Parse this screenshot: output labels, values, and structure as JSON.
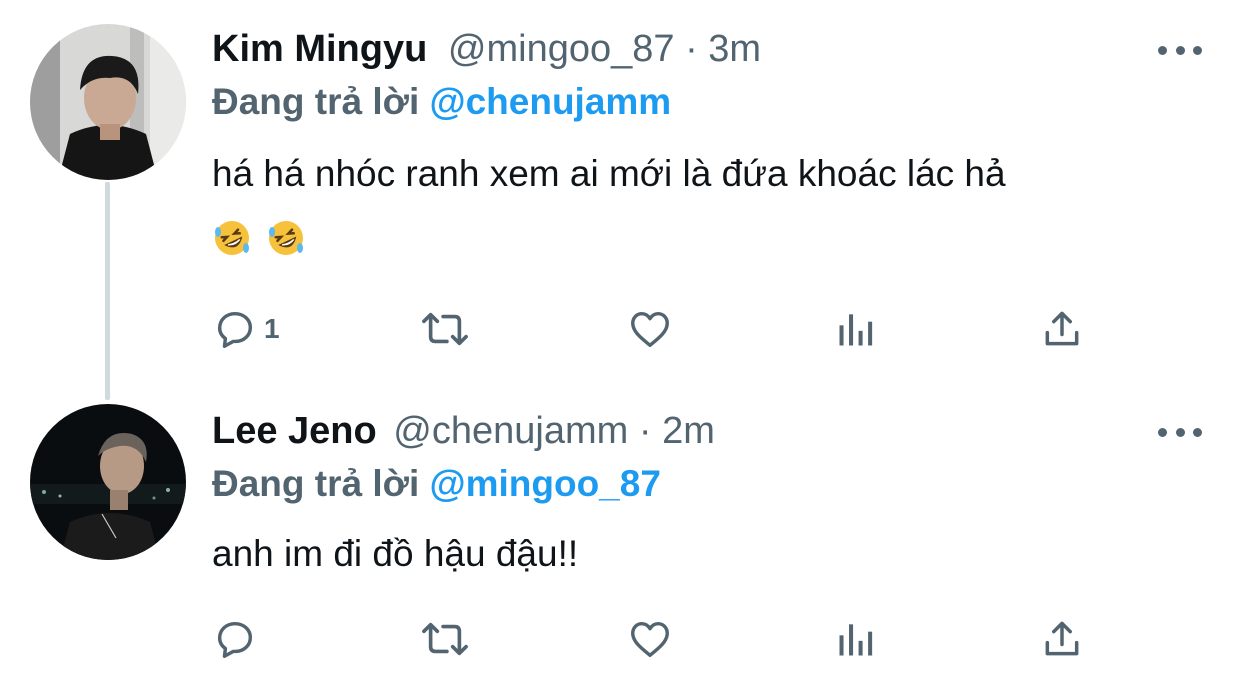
{
  "tweets": [
    {
      "name": "Kim Mingyu",
      "handle": "@mingoo_87",
      "separator": "·",
      "time": "3m",
      "reply_prefix": "Đang trả lời",
      "reply_handle": "@chenujamm",
      "text": "há há nhóc ranh xem ai mới là đứa khoác lác hả",
      "emojis": [
        "rolling-on-floor-laughing-emoji",
        "rolling-on-floor-laughing-emoji"
      ],
      "reply_count": "1"
    },
    {
      "name": "Lee Jeno",
      "handle": "@chenujamm",
      "separator": "·",
      "time": "2m",
      "reply_prefix": "Đang trả lời",
      "reply_handle": "@mingoo_87",
      "text": "anh im đi đồ hậu đậu!!",
      "reply_count": ""
    }
  ],
  "colors": {
    "primary_text": "#0f1419",
    "secondary_text": "#536471",
    "link": "#1d9bf0",
    "thread_line": "#cfd9de"
  },
  "icons": [
    "reply-icon",
    "retweet-icon",
    "like-icon",
    "analytics-icon",
    "share-icon",
    "more-icon"
  ]
}
